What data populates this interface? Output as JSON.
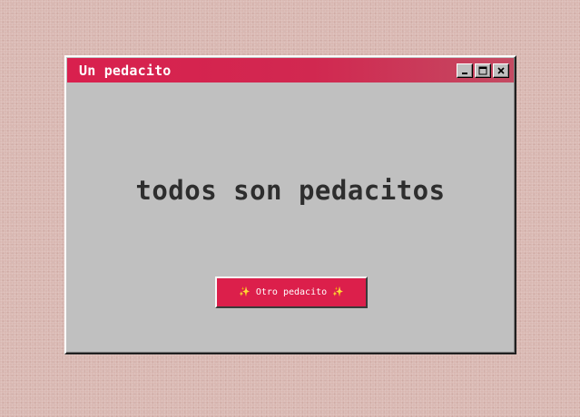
{
  "window": {
    "title": "Un pedacito",
    "controls": {
      "minimize": "_",
      "maximize": "□",
      "close": "✕"
    }
  },
  "content": {
    "headline": "todos son pedacitos",
    "button_label": "✨ Otro pedacito ✨"
  },
  "colors": {
    "accent": "#d9204e",
    "window_bg": "#c0c0c0",
    "desktop_bg": "#d9b8b2",
    "text": "#2e2e2e"
  }
}
